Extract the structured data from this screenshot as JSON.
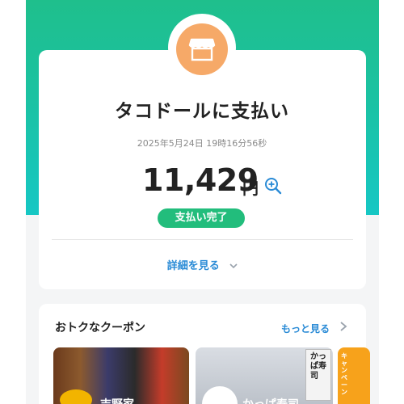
{
  "payment": {
    "merchant": "タコドールに支払い",
    "timestamp": "2025年5月24日 19時16分56秒",
    "amount": "11,429",
    "currency_unit": "円",
    "status": "支払い完了",
    "details_link": "詳細を見る"
  },
  "coupons": {
    "section_title": "おトクなクーポン",
    "more_link": "もっと見る",
    "items": [
      {
        "label": "吉野家"
      },
      {
        "label": "かっぱ寿司"
      },
      {
        "label": "キャンペーン"
      }
    ],
    "sign_text": "かっぱ寿司"
  },
  "colors": {
    "hero_top": "#1fbf8c",
    "hero_bottom": "#16c7c4",
    "status_green": "#22bd7c",
    "link_blue": "#2a8bd6",
    "store_icon_bg": "#f6a968"
  },
  "icons": {
    "store": "store-icon",
    "zoom": "zoom-in-icon",
    "details_chevron": "chevron-down-icon",
    "more_chevron": "chevron-right-icon"
  }
}
